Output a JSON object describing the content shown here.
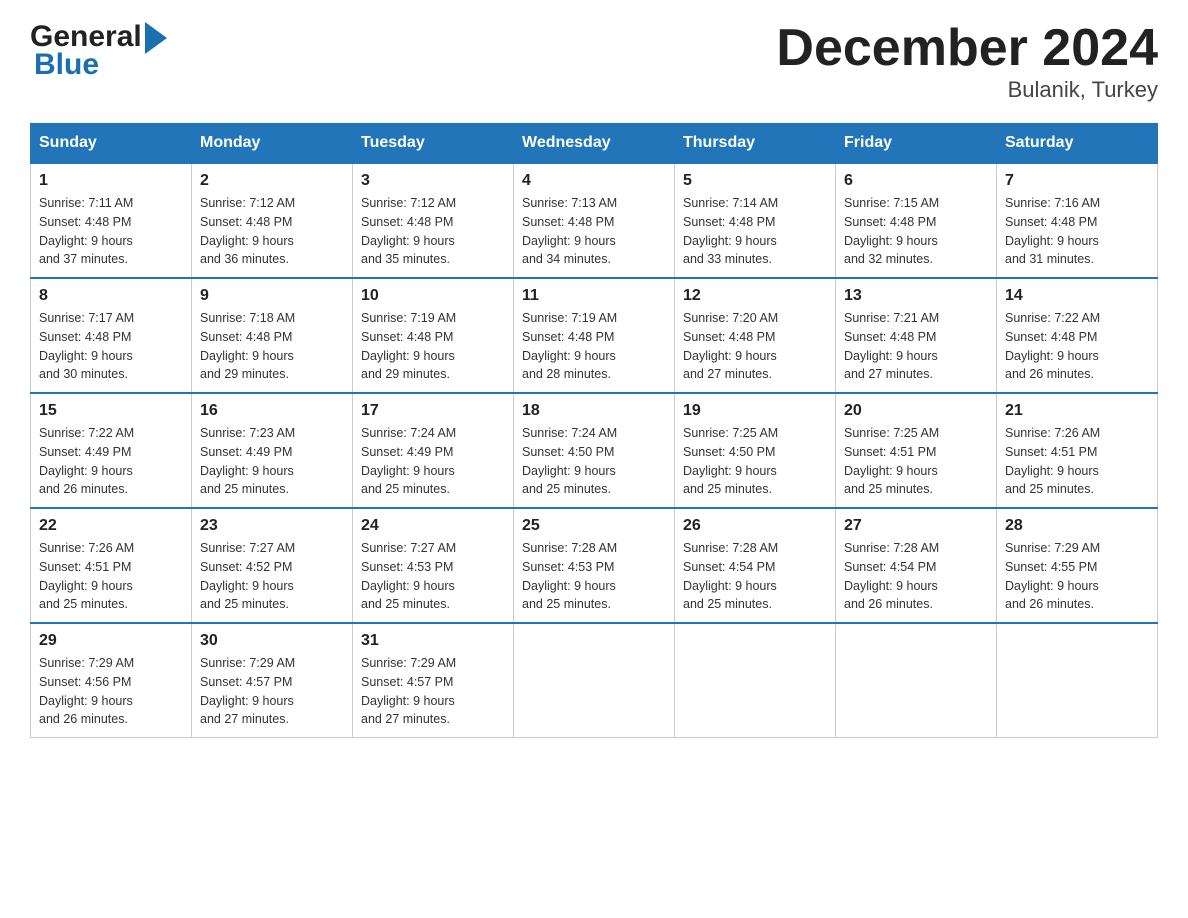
{
  "header": {
    "logo_general": "General",
    "logo_blue": "Blue",
    "title": "December 2024",
    "subtitle": "Bulanik, Turkey"
  },
  "days_of_week": [
    "Sunday",
    "Monday",
    "Tuesday",
    "Wednesday",
    "Thursday",
    "Friday",
    "Saturday"
  ],
  "weeks": [
    [
      {
        "day": "1",
        "sunrise": "7:11 AM",
        "sunset": "4:48 PM",
        "daylight": "9 hours and 37 minutes."
      },
      {
        "day": "2",
        "sunrise": "7:12 AM",
        "sunset": "4:48 PM",
        "daylight": "9 hours and 36 minutes."
      },
      {
        "day": "3",
        "sunrise": "7:12 AM",
        "sunset": "4:48 PM",
        "daylight": "9 hours and 35 minutes."
      },
      {
        "day": "4",
        "sunrise": "7:13 AM",
        "sunset": "4:48 PM",
        "daylight": "9 hours and 34 minutes."
      },
      {
        "day": "5",
        "sunrise": "7:14 AM",
        "sunset": "4:48 PM",
        "daylight": "9 hours and 33 minutes."
      },
      {
        "day": "6",
        "sunrise": "7:15 AM",
        "sunset": "4:48 PM",
        "daylight": "9 hours and 32 minutes."
      },
      {
        "day": "7",
        "sunrise": "7:16 AM",
        "sunset": "4:48 PM",
        "daylight": "9 hours and 31 minutes."
      }
    ],
    [
      {
        "day": "8",
        "sunrise": "7:17 AM",
        "sunset": "4:48 PM",
        "daylight": "9 hours and 30 minutes."
      },
      {
        "day": "9",
        "sunrise": "7:18 AM",
        "sunset": "4:48 PM",
        "daylight": "9 hours and 29 minutes."
      },
      {
        "day": "10",
        "sunrise": "7:19 AM",
        "sunset": "4:48 PM",
        "daylight": "9 hours and 29 minutes."
      },
      {
        "day": "11",
        "sunrise": "7:19 AM",
        "sunset": "4:48 PM",
        "daylight": "9 hours and 28 minutes."
      },
      {
        "day": "12",
        "sunrise": "7:20 AM",
        "sunset": "4:48 PM",
        "daylight": "9 hours and 27 minutes."
      },
      {
        "day": "13",
        "sunrise": "7:21 AM",
        "sunset": "4:48 PM",
        "daylight": "9 hours and 27 minutes."
      },
      {
        "day": "14",
        "sunrise": "7:22 AM",
        "sunset": "4:48 PM",
        "daylight": "9 hours and 26 minutes."
      }
    ],
    [
      {
        "day": "15",
        "sunrise": "7:22 AM",
        "sunset": "4:49 PM",
        "daylight": "9 hours and 26 minutes."
      },
      {
        "day": "16",
        "sunrise": "7:23 AM",
        "sunset": "4:49 PM",
        "daylight": "9 hours and 25 minutes."
      },
      {
        "day": "17",
        "sunrise": "7:24 AM",
        "sunset": "4:49 PM",
        "daylight": "9 hours and 25 minutes."
      },
      {
        "day": "18",
        "sunrise": "7:24 AM",
        "sunset": "4:50 PM",
        "daylight": "9 hours and 25 minutes."
      },
      {
        "day": "19",
        "sunrise": "7:25 AM",
        "sunset": "4:50 PM",
        "daylight": "9 hours and 25 minutes."
      },
      {
        "day": "20",
        "sunrise": "7:25 AM",
        "sunset": "4:51 PM",
        "daylight": "9 hours and 25 minutes."
      },
      {
        "day": "21",
        "sunrise": "7:26 AM",
        "sunset": "4:51 PM",
        "daylight": "9 hours and 25 minutes."
      }
    ],
    [
      {
        "day": "22",
        "sunrise": "7:26 AM",
        "sunset": "4:51 PM",
        "daylight": "9 hours and 25 minutes."
      },
      {
        "day": "23",
        "sunrise": "7:27 AM",
        "sunset": "4:52 PM",
        "daylight": "9 hours and 25 minutes."
      },
      {
        "day": "24",
        "sunrise": "7:27 AM",
        "sunset": "4:53 PM",
        "daylight": "9 hours and 25 minutes."
      },
      {
        "day": "25",
        "sunrise": "7:28 AM",
        "sunset": "4:53 PM",
        "daylight": "9 hours and 25 minutes."
      },
      {
        "day": "26",
        "sunrise": "7:28 AM",
        "sunset": "4:54 PM",
        "daylight": "9 hours and 25 minutes."
      },
      {
        "day": "27",
        "sunrise": "7:28 AM",
        "sunset": "4:54 PM",
        "daylight": "9 hours and 26 minutes."
      },
      {
        "day": "28",
        "sunrise": "7:29 AM",
        "sunset": "4:55 PM",
        "daylight": "9 hours and 26 minutes."
      }
    ],
    [
      {
        "day": "29",
        "sunrise": "7:29 AM",
        "sunset": "4:56 PM",
        "daylight": "9 hours and 26 minutes."
      },
      {
        "day": "30",
        "sunrise": "7:29 AM",
        "sunset": "4:57 PM",
        "daylight": "9 hours and 27 minutes."
      },
      {
        "day": "31",
        "sunrise": "7:29 AM",
        "sunset": "4:57 PM",
        "daylight": "9 hours and 27 minutes."
      },
      null,
      null,
      null,
      null
    ]
  ],
  "labels": {
    "sunrise": "Sunrise:",
    "sunset": "Sunset:",
    "daylight": "Daylight:"
  }
}
